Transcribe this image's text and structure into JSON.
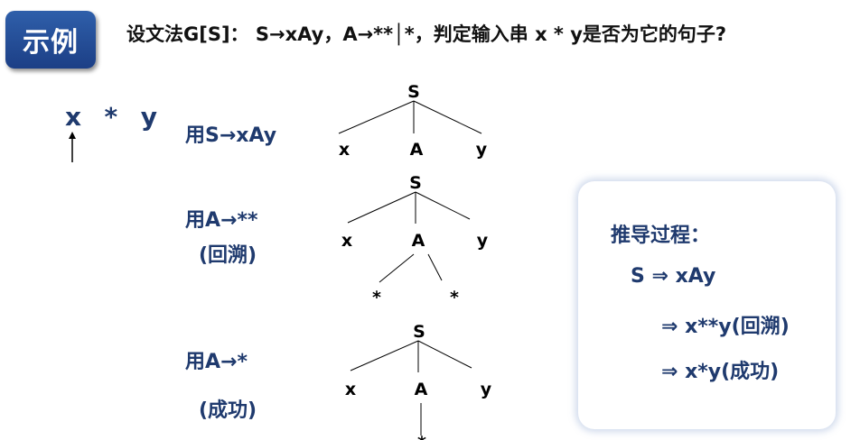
{
  "badge": {
    "label": "示例"
  },
  "title": "设文法G[S]： S→xAy，A→**│*，判定输入串  x * y是否为它的句子?",
  "input_string": "x  *  y",
  "steps": [
    {
      "rule": "用S→xAy"
    },
    {
      "rule": "用A→**",
      "note": "(回溯)"
    },
    {
      "rule": "用A→*",
      "note": "(成功)"
    }
  ],
  "trees": [
    {
      "root": "S",
      "children": [
        "x",
        "A",
        "y"
      ],
      "a_children": []
    },
    {
      "root": "S",
      "children": [
        "x",
        "A",
        "y"
      ],
      "a_children": [
        "*",
        "*"
      ]
    },
    {
      "root": "S",
      "children": [
        "x",
        "A",
        "y"
      ],
      "a_children": [
        "*"
      ]
    }
  ],
  "derivation": {
    "heading": "推导过程：",
    "line1": "S ⇒ xAy",
    "line2": "⇒ x**y(回溯)",
    "line3": "⇒ x*y(成功)"
  }
}
